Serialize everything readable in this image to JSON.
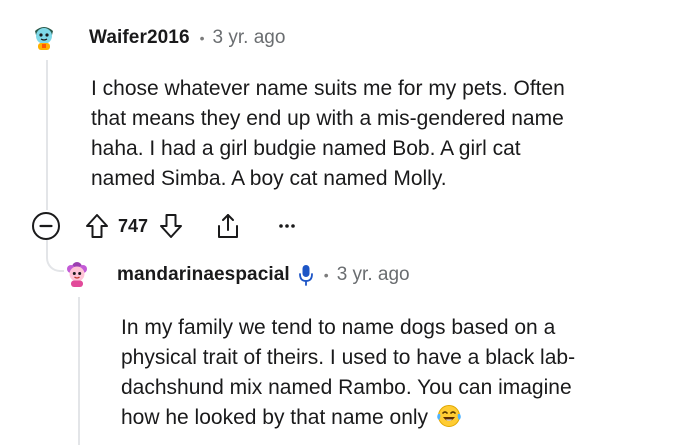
{
  "comment": {
    "username": "Waifer2016",
    "separator": "•",
    "timestamp": "3 yr. ago",
    "body_lines": [
      "I chose whatever name suits me for my pets. Often",
      "that means they end up with a mis-gendered name",
      "haha. I had a girl budgie named Bob. A girl cat",
      "named Simba. A boy cat named Molly."
    ],
    "actions": {
      "vote_count": "747",
      "more_label": "•••"
    }
  },
  "reply": {
    "username": "mandarinaespacial",
    "separator": "•",
    "timestamp": "3 yr. ago",
    "body_lines": [
      "In my family we tend to name dogs based on a",
      "physical trait of theirs. I used to have a black lab-",
      "dachshund mix named Rambo. You can imagine",
      "how he looked by that name only"
    ]
  },
  "icons": {
    "avatar_1": "snoo-avatar-icon",
    "avatar_2": "snoo-avatar-icon",
    "mic": "microphone-icon",
    "emoji": "laughing-tears-emoji",
    "collapse": "collapse-minus-icon",
    "upvote": "upvote-arrow-icon",
    "downvote": "downvote-arrow-icon",
    "share": "share-icon",
    "more": "more-dots-icon"
  },
  "colors": {
    "text": "#1a1a1b",
    "meta": "#6a6d70",
    "rail": "#e3e5e8",
    "mic_blue": "#1d55c6"
  }
}
